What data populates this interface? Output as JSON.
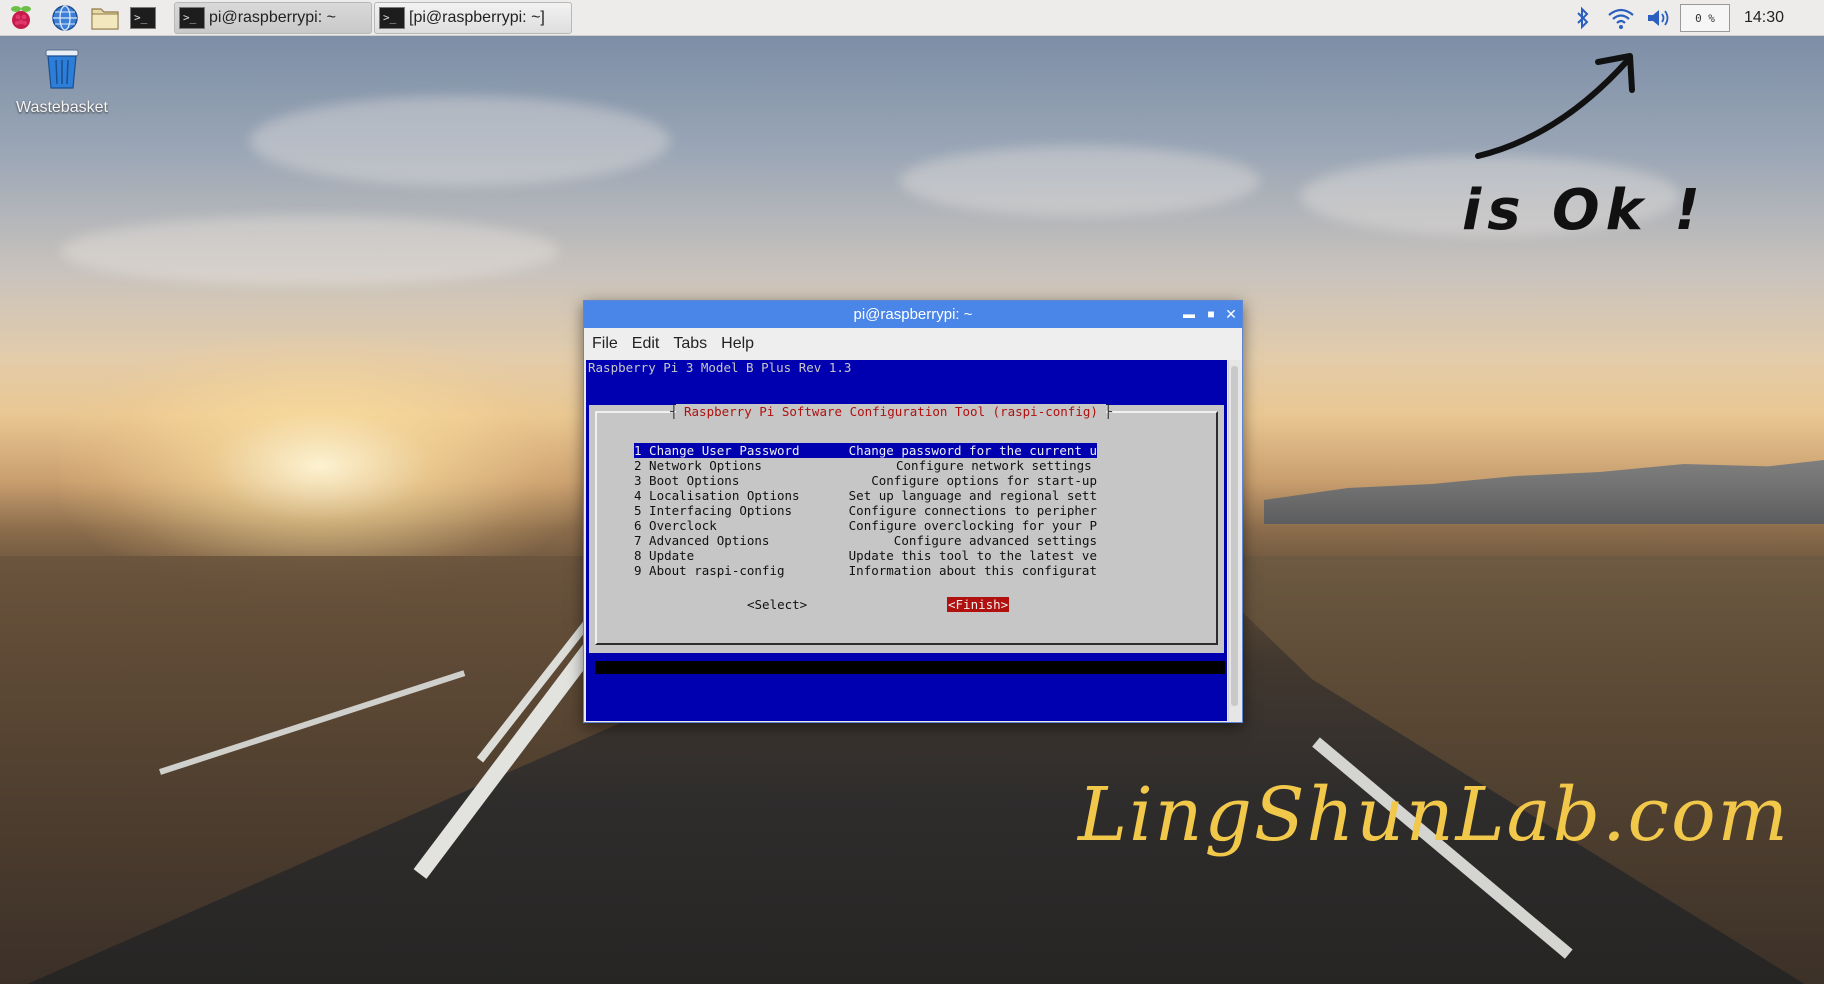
{
  "colors": {
    "terminal_bg": "#0000b0",
    "dialog_bg": "#c6c6c6",
    "accent_red": "#b0110f",
    "titlebar": "#4a86e8",
    "brand_text": "#f2c84b"
  },
  "taskbar": {
    "launchers": [
      {
        "icon": "raspberry-menu-icon"
      },
      {
        "icon": "web-browser-globe-icon"
      },
      {
        "icon": "file-manager-folder-icon"
      },
      {
        "icon": "terminal-icon"
      }
    ],
    "tasks": [
      {
        "label": "pi@raspberrypi: ~",
        "icon": "terminal-icon"
      },
      {
        "label": "[pi@raspberrypi: ~]",
        "icon": "terminal-icon"
      }
    ],
    "tray": {
      "bluetooth_icon": "bluetooth-icon",
      "wifi_icon": "wifi-icon",
      "volume_icon": "volume-icon",
      "cpu": "0 %",
      "clock": "14:30"
    }
  },
  "desktop": {
    "trash_label": "Wastebasket",
    "annotation": "is Ok !",
    "brand": "LingShunLab.com"
  },
  "window": {
    "title": "pi@raspberrypi: ~",
    "menu": [
      "File",
      "Edit",
      "Tabs",
      "Help"
    ],
    "terminal": {
      "header": "Raspberry Pi 3 Model B Plus Rev 1.3",
      "dialog_title": "Raspberry Pi Software Configuration Tool (raspi-config)",
      "items": [
        {
          "option": "1 Change User Password",
          "desc": "Change password for the current u"
        },
        {
          "option": "2 Network Options",
          "desc": "Configure network settings"
        },
        {
          "option": "3 Boot Options",
          "desc": "Configure options for start-up"
        },
        {
          "option": "4 Localisation Options",
          "desc": "Set up language and regional sett"
        },
        {
          "option": "5 Interfacing Options",
          "desc": "Configure connections to peripher"
        },
        {
          "option": "6 Overclock",
          "desc": "Configure overclocking for your P"
        },
        {
          "option": "7 Advanced Options",
          "desc": "Configure advanced settings"
        },
        {
          "option": "8 Update",
          "desc": "Update this tool to the latest ve"
        },
        {
          "option": "9 About raspi-config",
          "desc": "Information about this configurat"
        }
      ],
      "select_label": "<Select>",
      "finish_label": "<Finish>"
    }
  }
}
